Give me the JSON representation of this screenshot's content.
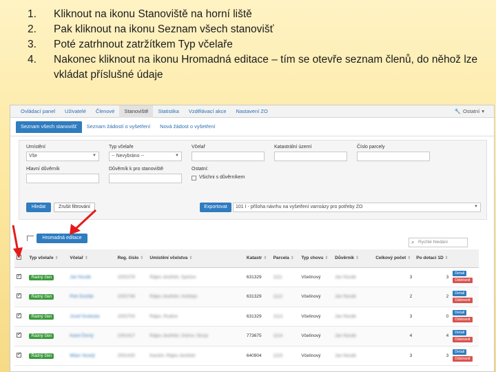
{
  "instructions": [
    {
      "num": "1.",
      "text": "Kliknout na ikonu Stanoviště na horní liště"
    },
    {
      "num": "2.",
      "text": "Pak kliknout na ikonu Seznam všech stanovišť"
    },
    {
      "num": "3.",
      "text": "Poté zatrhnout zatržítkem Typ včelaře"
    },
    {
      "num": "4.",
      "text": "Nakonec kliknout na ikonu Hromadná editace – tím se otevře seznam členů, do něhož lze vkládat příslušné údaje"
    }
  ],
  "navbar": {
    "items": [
      "Ovládací panel",
      "Uživatelé",
      "Členové",
      "Stanoviště",
      "Statistika",
      "Vzdělávací akce",
      "Nastavení ZO"
    ],
    "active_index": 3,
    "right_label": "Ostatní",
    "right_icon": "wrench-icon"
  },
  "subtabs": {
    "items": [
      "Seznam všech stanovišť",
      "Seznam žádostí o vyšetření",
      "Nová žádost o vyšetření"
    ],
    "active_index": 0
  },
  "filters": {
    "umisteni_label": "Umístění",
    "umisteni_value": "Vše",
    "typ_vcelare_label": "Typ včelaře",
    "typ_vcelare_value": "-- Nevybráno --",
    "vcelar_label": "Včelař",
    "katastralni_label": "Katastrální území",
    "cislo_parcely_label": "Číslo parcely",
    "hlavni_duvernik_label": "Hlavní důvěrník",
    "duvernik_label": "Důvěrník k pro stanoviště",
    "ostatni_label": "Ostatní:",
    "vsichni_label": "Všichni s důvěrníkem",
    "hledat_button": "Hledat",
    "zrusit_button": "Zrušit filtrování",
    "export_button": "Exportovat",
    "export_select": "101 I - příloha návrhu na vyšetření varroázy pro potřeby ZO"
  },
  "table": {
    "bulk_edit_button": "Hromadná editace",
    "search_placeholder": "Rychlé hledání",
    "headers": [
      "Typ včelaře",
      "Včelař",
      "Reg. číslo",
      "Umístění včelstva",
      "Katastr",
      "Parcela",
      "Typ chovu",
      "Důvěrník",
      "Celkový počet",
      "Po dotaci 1D"
    ],
    "rows": [
      {
        "typ": "Řádný člen",
        "vcelar": "Jan Novák",
        "reg": "1002278",
        "umisteni": "Rájec-Jestřebí, Spešov",
        "katastr": "631329",
        "parcela": "1111",
        "chov": "Včelínový",
        "duvernik": "Jan Novák",
        "celkem": "3",
        "dotace": "3"
      },
      {
        "typ": "Řádný člen",
        "vcelar": "Petr Dvořák",
        "reg": "1002748",
        "umisteni": "Rájec-Jestřebí, Holštejn",
        "katastr": "631329",
        "parcela": "1112",
        "chov": "Včelínový",
        "duvernik": "Jan Novák",
        "celkem": "2",
        "dotace": "2"
      },
      {
        "typ": "Řádný člen",
        "vcelar": "Josef Svoboda",
        "reg": "1002703",
        "umisteni": "Rájec, Rudice",
        "katastr": "631329",
        "parcela": "1113",
        "chov": "Včelínový",
        "duvernik": "Jan Novák",
        "celkem": "3",
        "dotace": "0"
      },
      {
        "typ": "Řádný člen",
        "vcelar": "Karel Černý",
        "reg": "1001417",
        "umisteni": "Rájec-Jestřebí, Ostrov, Sloup",
        "katastr": "773675",
        "parcela": "1114",
        "chov": "Včelínový",
        "duvernik": "Jan Novák",
        "celkem": "4",
        "dotace": "4"
      },
      {
        "typ": "Řádný člen",
        "vcelar": "Milan Veselý",
        "reg": "2001430",
        "umisteni": "Karolín, Rájec-Jestřebí",
        "katastr": "640904",
        "parcela": "1115",
        "chov": "Včelínový",
        "duvernik": "Jan Novák",
        "celkem": "3",
        "dotace": "3"
      }
    ],
    "detail_label": "Detail",
    "delete_label": "Odstranit"
  },
  "colors": {
    "accent_blue": "#2f7cc0",
    "success_green": "#3c9a3c",
    "danger_red": "#d9534f",
    "arrow_red": "#e31b1b",
    "slide_background": "#fde9a3"
  }
}
